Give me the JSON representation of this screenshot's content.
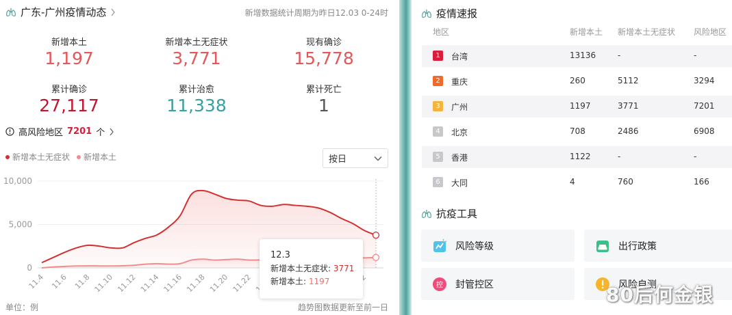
{
  "left": {
    "title": "广东-广州疫情动态",
    "period_note": "新增数据统计周期为昨日12.03 0-24时",
    "stats": [
      {
        "label": "新增本土",
        "value": "1,197",
        "color": "#e45757"
      },
      {
        "label": "新增本土无症状",
        "value": "3,771",
        "color": "#e45757"
      },
      {
        "label": "现有确诊",
        "value": "15,778",
        "color": "#e45757"
      },
      {
        "label": "累计确诊",
        "value": "27,117",
        "color": "#c2142f"
      },
      {
        "label": "累计治愈",
        "value": "11,338",
        "color": "#3a9fa0"
      },
      {
        "label": "累计死亡",
        "value": "1",
        "color": "#555555"
      }
    ],
    "risk": {
      "label": "高风险地区",
      "count": "7201",
      "unit": "个"
    },
    "legend": [
      {
        "name": "新增本土无症状",
        "color": "#d32f2f"
      },
      {
        "name": "新增本土",
        "color": "#f28c8c"
      }
    ],
    "mode_select": {
      "value": "按日"
    },
    "tooltip": {
      "date": "12.3",
      "row1_label": "新增本土无症状:",
      "row1_value": "3771",
      "row2_label": "新增本土:",
      "row2_value": "1197"
    },
    "footer_left": "单位：例",
    "footer_right": "趋势图数据更新至前一日"
  },
  "chart_data": {
    "type": "line",
    "x": [
      "11.4",
      "11.5",
      "11.6",
      "11.7",
      "11.8",
      "11.9",
      "11.10",
      "11.11",
      "11.12",
      "11.13",
      "11.14",
      "11.15",
      "11.16",
      "11.17",
      "11.18",
      "11.19",
      "11.20",
      "11.21",
      "11.22",
      "11.23",
      "11.24",
      "11.25",
      "11.26",
      "11.27",
      "11.28",
      "11.29",
      "11.30",
      "12.1",
      "12.2",
      "12.3"
    ],
    "x_tick_labels": [
      "11.4",
      "11.6",
      "11.8",
      "11.10",
      "11.12",
      "11.14",
      "11.16",
      "11.18",
      "11.20",
      "11.22",
      "11.24",
      "11.26",
      "11.28",
      "11.30",
      "12.2"
    ],
    "y_ticks": [
      "0",
      "5,000",
      "10,000"
    ],
    "ylim": [
      0,
      10000
    ],
    "series": [
      {
        "name": "新增本土无症状",
        "color": "#d32f2f",
        "values": [
          600,
          1200,
          1800,
          2300,
          2600,
          2500,
          2300,
          2300,
          2900,
          3400,
          3800,
          4700,
          6000,
          8500,
          8900,
          8500,
          8000,
          7800,
          7700,
          7200,
          7100,
          7300,
          7200,
          7100,
          6900,
          6400,
          5700,
          5100,
          4300,
          3771
        ]
      },
      {
        "name": "新增本土",
        "color": "#f28c8c",
        "values": [
          0,
          100,
          170,
          220,
          230,
          220,
          220,
          240,
          300,
          420,
          480,
          430,
          480,
          900,
          1000,
          900,
          950,
          1000,
          900,
          900,
          800,
          950,
          1200,
          1300,
          1350,
          1300,
          1100,
          1150,
          1150,
          1197
        ]
      }
    ]
  },
  "right": {
    "title": "疫情速报",
    "headers": [
      "地区",
      "新增本土",
      "新增本土无症状",
      "风险地区"
    ],
    "rows": [
      {
        "rank": "1",
        "rank_color": "#d81e3a",
        "region": "台湾",
        "local": "13136",
        "asym": "-",
        "risk": "-"
      },
      {
        "rank": "2",
        "rank_color": "#f06a2a",
        "region": "重庆",
        "local": "260",
        "asym": "5112",
        "risk": "3294"
      },
      {
        "rank": "3",
        "rank_color": "#f5b43c",
        "region": "广州",
        "local": "1197",
        "asym": "3771",
        "risk": "7201"
      },
      {
        "rank": "4",
        "rank_color": "#c8c8cc",
        "region": "北京",
        "local": "708",
        "asym": "2486",
        "risk": "6908"
      },
      {
        "rank": "5",
        "rank_color": "#c8c8cc",
        "region": "香港",
        "local": "1122",
        "asym": "-",
        "risk": "-"
      },
      {
        "rank": "6",
        "rank_color": "#c8c8cc",
        "region": "大同",
        "local": "4",
        "asym": "760",
        "risk": "166"
      }
    ],
    "tools_title": "抗疫工具",
    "tools": [
      {
        "label": "风险等级",
        "icon": "risk-level-icon"
      },
      {
        "label": "出行政策",
        "icon": "car-icon"
      },
      {
        "label": "封管控区",
        "icon": "control-zone-icon"
      },
      {
        "label": "风险自测",
        "icon": "warning-icon"
      }
    ],
    "watermark": "80后何金银"
  }
}
